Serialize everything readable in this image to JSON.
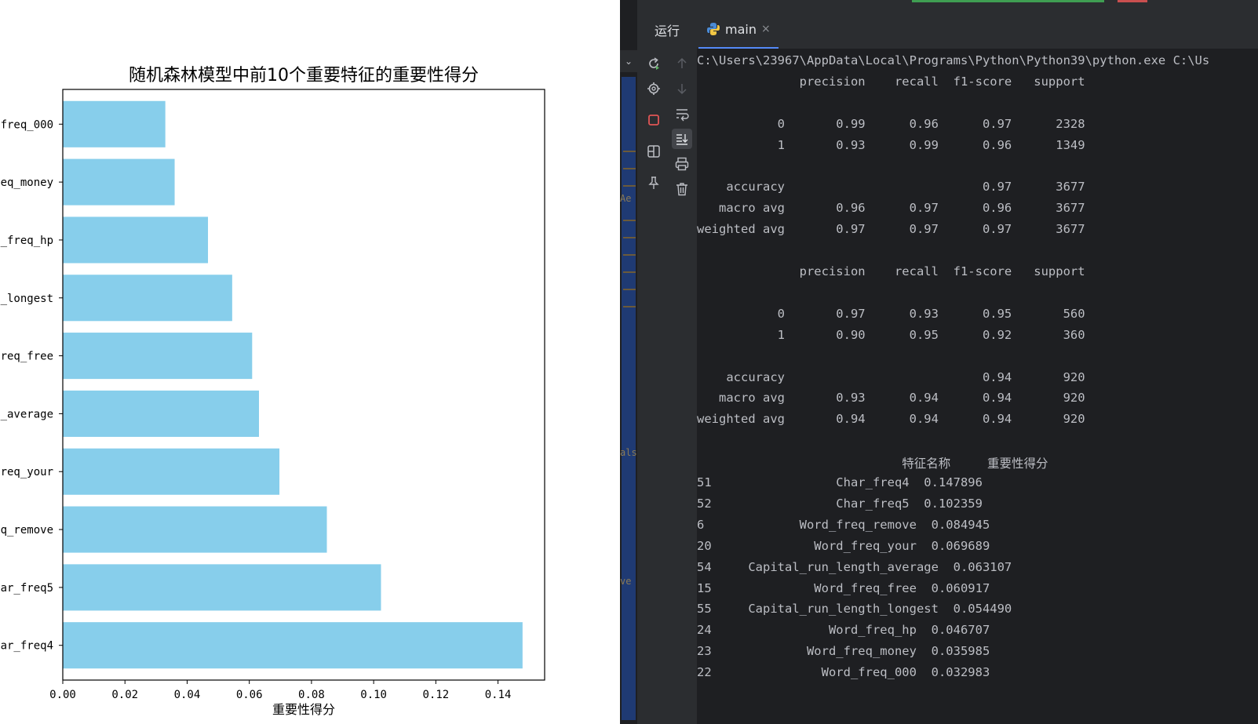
{
  "chart_data": {
    "type": "bar",
    "orientation": "horizontal",
    "title": "随机森林模型中前10个重要特征的重要性得分",
    "xlabel": "重要性得分",
    "ylabel": "",
    "categories": [
      "ar_freq4",
      "ar_freq5",
      "q_remove",
      "req_your",
      "_average",
      "req_free",
      "_longest",
      "_freq_hp",
      "eq_money",
      "freq_000"
    ],
    "values": [
      0.147896,
      0.102359,
      0.084945,
      0.069689,
      0.063107,
      0.060917,
      0.05449,
      0.046707,
      0.035985,
      0.032983
    ],
    "xlim": [
      0,
      0.155
    ],
    "xticks": [
      "0.00",
      "0.02",
      "0.04",
      "0.06",
      "0.08",
      "0.10",
      "0.12",
      "0.14"
    ],
    "bar_color": "#87ceeb",
    "grid": false
  },
  "ide": {
    "run_label": "运行",
    "tab_label": "main",
    "tab_close": "×",
    "editor_fragments": [
      "Ae",
      "als",
      "ve"
    ],
    "toolbar_icons": [
      "rerun-icon",
      "settings-icon",
      "stop-icon",
      "layout-icon",
      "pin-icon",
      "up-arrow-icon",
      "down-arrow-icon",
      "soft-wrap-icon",
      "scroll-to-end-icon",
      "print-icon",
      "trash-icon"
    ],
    "colors": {
      "background": "#1e1f22",
      "panel": "#2b2d30",
      "text": "#bcbec4",
      "stop_red": "#e05555",
      "rerun_green": "#5fb865"
    },
    "console_lines": [
      "C:\\Users\\23967\\AppData\\Local\\Programs\\Python\\Python39\\python.exe C:\\Us",
      "              precision    recall  f1-score   support",
      "",
      "           0       0.99      0.96      0.97      2328",
      "           1       0.93      0.99      0.96      1349",
      "",
      "    accuracy                           0.97      3677",
      "   macro avg       0.96      0.97      0.96      3677",
      "weighted avg       0.97      0.97      0.97      3677",
      "",
      "              precision    recall  f1-score   support",
      "",
      "           0       0.97      0.93      0.95       560",
      "           1       0.90      0.95      0.92       360",
      "",
      "    accuracy                           0.94       920",
      "   macro avg       0.93      0.94      0.94       920",
      "weighted avg       0.94      0.94      0.94       920",
      "",
      "                            特征名称     重要性得分",
      "51                 Char_freq4  0.147896",
      "52                 Char_freq5  0.102359",
      "6             Word_freq_remove  0.084945",
      "20              Word_freq_your  0.069689",
      "54     Capital_run_length_average  0.063107",
      "15              Word_freq_free  0.060917",
      "55     Capital_run_length_longest  0.054490",
      "24                Word_freq_hp  0.046707",
      "23             Word_freq_money  0.035985",
      "22               Word_freq_000  0.032983"
    ]
  }
}
